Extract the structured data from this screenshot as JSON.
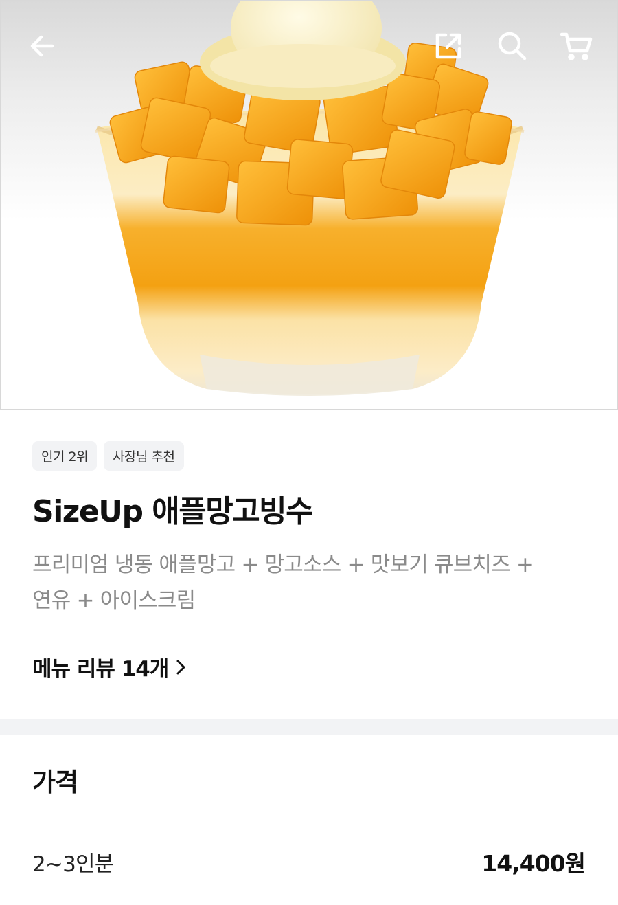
{
  "header": {
    "icons": [
      "back-arrow-icon",
      "share-icon",
      "search-icon",
      "cart-icon"
    ]
  },
  "hero": {
    "alt": "mango bingsu"
  },
  "badges": [
    "인기 2위",
    "사장님 추천"
  ],
  "menu": {
    "title": "SizeUp 애플망고빙수",
    "description_lines": [
      "프리미엄 냉동 애플망고 + 망고소스 + 맛보기 큐브치즈 +",
      "연유 + 아이스크림"
    ],
    "review_link": "메뉴 리뷰 14개"
  },
  "price": {
    "heading": "가격",
    "options": [
      {
        "size": "2~3인분",
        "amount": "14,400원"
      }
    ]
  },
  "colors": {
    "badge_bg": "#f2f3f5",
    "divider": "#f2f3f5",
    "mango": "#f7a21b",
    "text_primary": "#111111",
    "text_secondary": "#8a8a8a"
  }
}
